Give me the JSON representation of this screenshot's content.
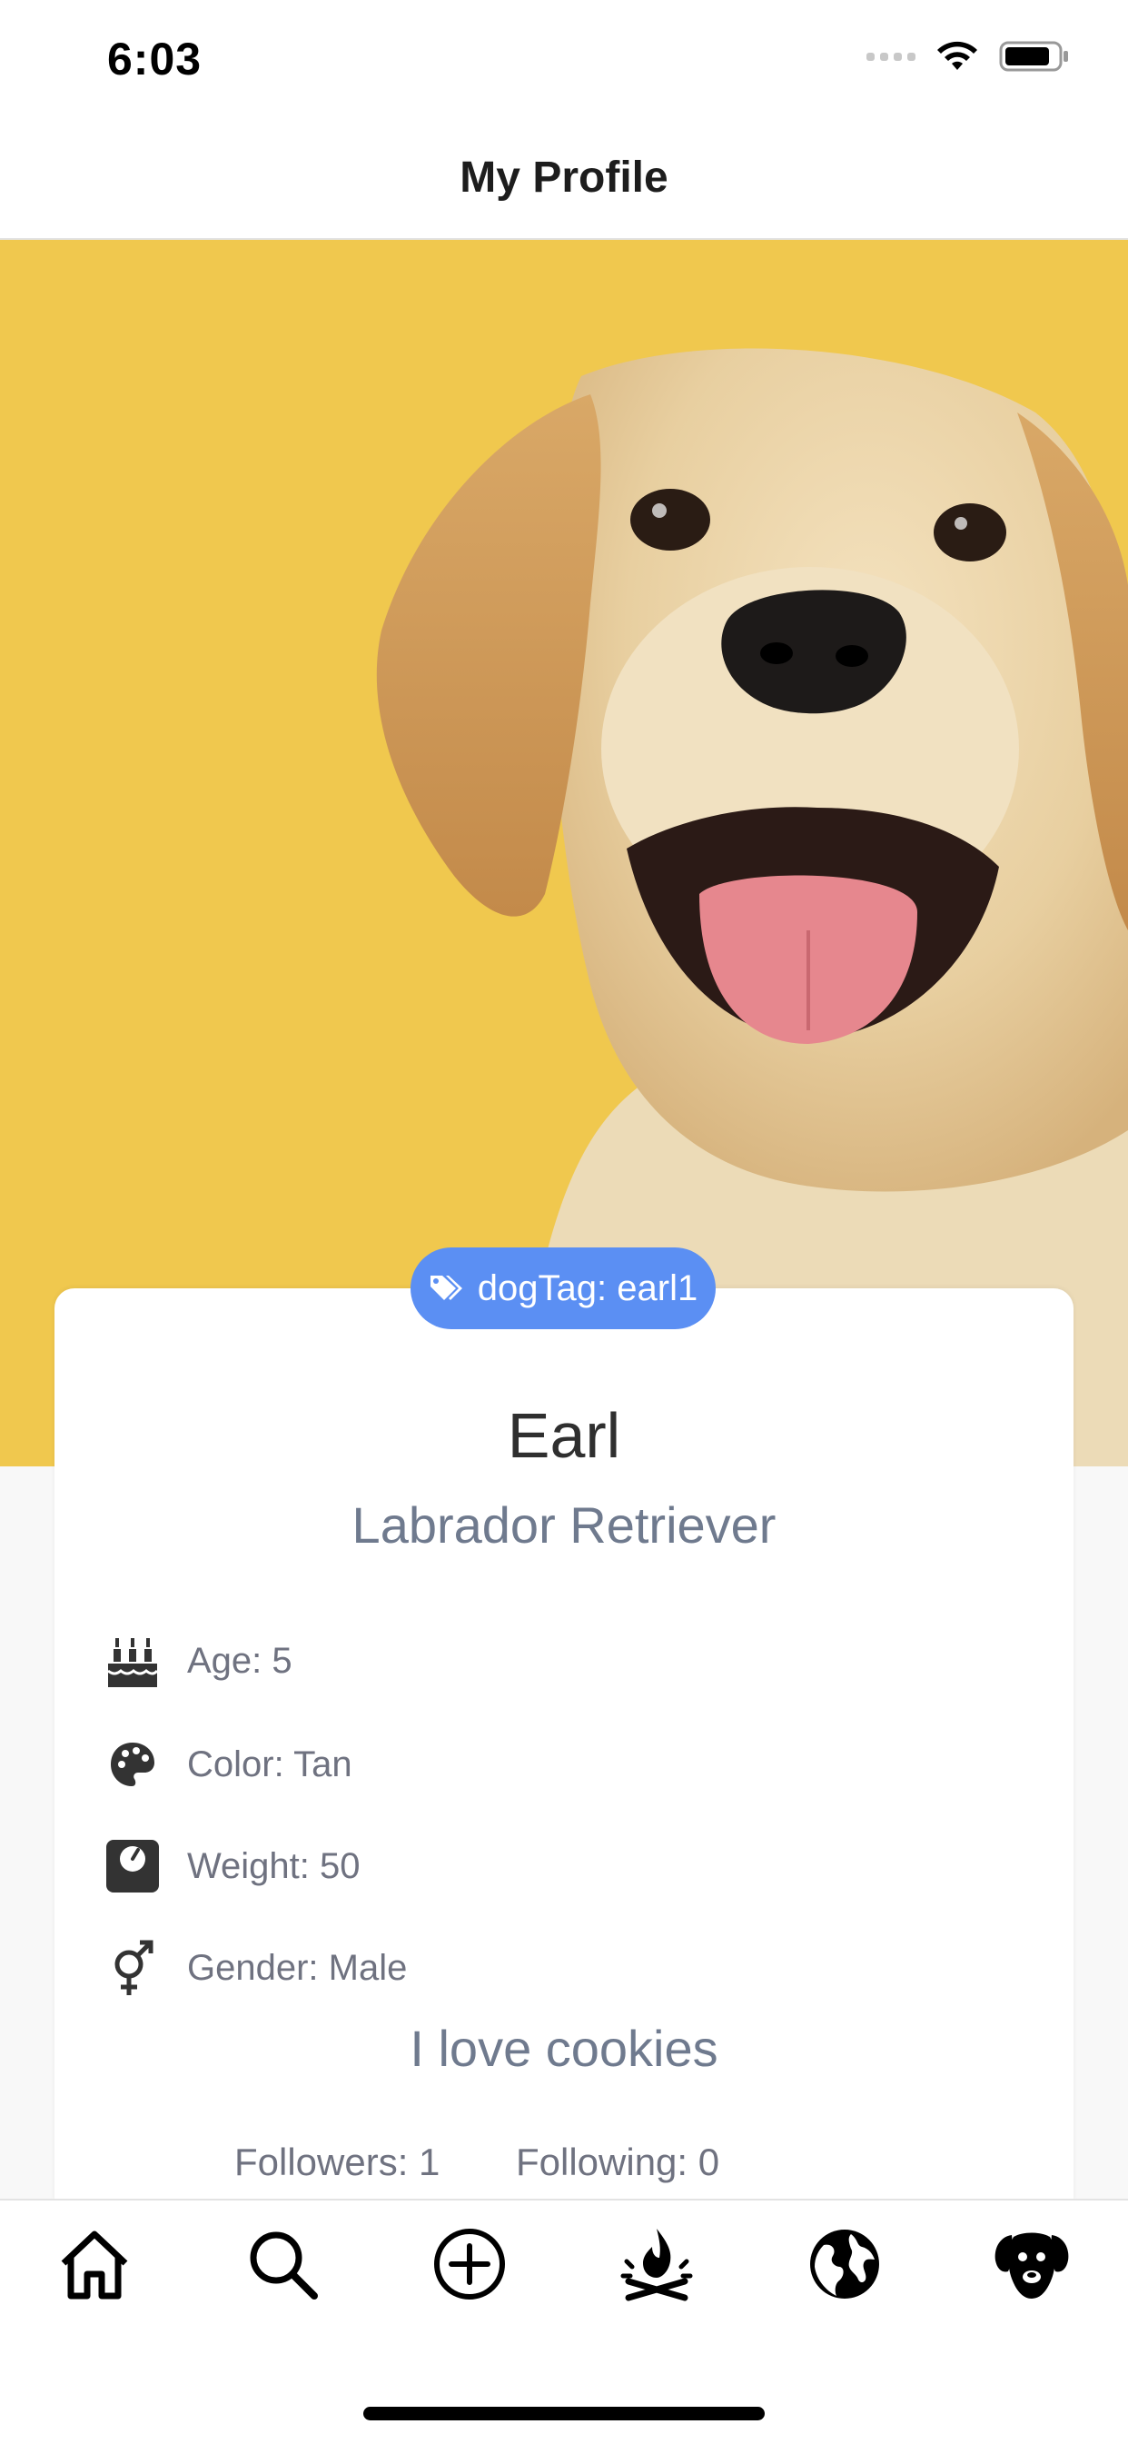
{
  "status_bar": {
    "time": "6:03"
  },
  "nav": {
    "title": "My Profile"
  },
  "profile": {
    "dog_tag": "dogTag: earl1",
    "name": "Earl",
    "breed": "Labrador Retriever",
    "details": {
      "age": "Age: 5",
      "color": "Color: Tan",
      "weight": "Weight: 50",
      "gender": "Gender: Male"
    },
    "bio": "I love cookies",
    "followers": "Followers: 1",
    "following": "Following: 0"
  },
  "tab_bar": {
    "items": [
      "home-icon",
      "search-icon",
      "add-circle-icon",
      "campfire-icon",
      "globe-icon",
      "dog-icon"
    ]
  },
  "colors": {
    "accent": "#5b8ff3",
    "hero_background": "#f0c84e",
    "secondary_text": "#6f7a8e"
  }
}
